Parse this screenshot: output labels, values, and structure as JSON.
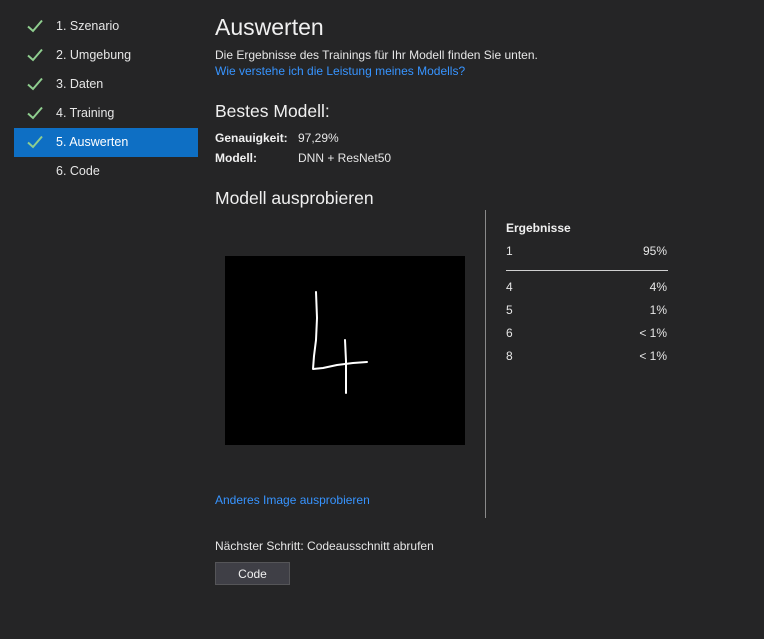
{
  "sidebar": {
    "steps": [
      {
        "label": "1. Szenario",
        "completed": true
      },
      {
        "label": "2. Umgebung",
        "completed": true
      },
      {
        "label": "3. Daten",
        "completed": true
      },
      {
        "label": "4. Training",
        "completed": true
      },
      {
        "label": "5. Auswerten",
        "completed": true,
        "active": true
      },
      {
        "label": "6. Code",
        "completed": false
      }
    ]
  },
  "main": {
    "title": "Auswerten",
    "intro": "Die Ergebnisse des Trainings für Ihr Modell finden Sie unten.",
    "help_link": "Wie verstehe ich die Leistung meines Modells?",
    "best_model": {
      "title": "Bestes Modell:",
      "accuracy_label": "Genauigkeit:",
      "accuracy_value": "97,29%",
      "model_label": "Modell:",
      "model_value": "DNN + ResNet50"
    },
    "try_model": {
      "title": "Modell ausprobieren",
      "try_other_link": "Anderes Image ausprobieren"
    },
    "results": {
      "header": "Ergebnisse",
      "top": {
        "class": "1",
        "pct": "95%"
      },
      "others": [
        {
          "class": "4",
          "pct": "4%"
        },
        {
          "class": "5",
          "pct": "1%"
        },
        {
          "class": "6",
          "pct": "< 1%"
        },
        {
          "class": "8",
          "pct": "< 1%"
        }
      ]
    },
    "next_step": "Nächster Schritt: Codeausschnitt abrufen",
    "code_button": "Code"
  },
  "colors": {
    "background": "#252526",
    "active": "#0e6fc4",
    "link": "#3794ff",
    "check": "#8fce8f"
  }
}
